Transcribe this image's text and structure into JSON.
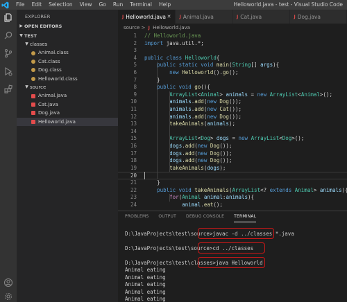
{
  "titlebar": {
    "menu": [
      "File",
      "Edit",
      "Selection",
      "View",
      "Go",
      "Run",
      "Terminal",
      "Help"
    ],
    "window_title": "Helloworld.java - test - Visual Studio Code"
  },
  "activity_icons": [
    "files-icon",
    "search-icon",
    "source-control-icon",
    "run-debug-icon",
    "extensions-icon",
    "account-icon",
    "settings-gear-icon"
  ],
  "sidebar": {
    "title": "EXPLORER",
    "open_editors": "OPEN EDITORS",
    "workspace": "TEST",
    "folders": [
      {
        "name": "classes",
        "files": [
          "Animal.class",
          "Cat.class",
          "Dog.class",
          "Helloworld.class"
        ]
      },
      {
        "name": "source",
        "files": [
          "Animal.java",
          "Cat.java",
          "Dog.java",
          "Helloworld.java"
        ]
      }
    ],
    "selected_file": "Helloworld.java"
  },
  "tabs": [
    {
      "label": "Helloworld.java",
      "active": true
    },
    {
      "label": "Animal.java",
      "active": false
    },
    {
      "label": "Cat.java",
      "active": false
    },
    {
      "label": "Dog.java",
      "active": false
    }
  ],
  "breadcrumb": {
    "folder": "source",
    "sep": ">",
    "icon": "J",
    "file": "Helloworld.java"
  },
  "editor": {
    "current_line": 20,
    "lines": [
      {
        "n": 1,
        "indent": 0,
        "t": [
          [
            "cm",
            "// Helloworld.java"
          ]
        ]
      },
      {
        "n": 2,
        "indent": 0,
        "t": [
          [
            "kw",
            "import "
          ],
          [
            "pl",
            "java.util.*;"
          ]
        ]
      },
      {
        "n": 3,
        "indent": 0,
        "t": []
      },
      {
        "n": 4,
        "indent": 0,
        "t": [
          [
            "kw",
            "public class "
          ],
          [
            "ty",
            "Helloworld"
          ],
          [
            "pl",
            "{"
          ]
        ]
      },
      {
        "n": 5,
        "indent": 1,
        "t": [
          [
            "kw",
            "public static void "
          ],
          [
            "fn",
            "main"
          ],
          [
            "pl",
            "("
          ],
          [
            "ty",
            "String"
          ],
          [
            "pl",
            "[] "
          ],
          [
            "var",
            "args"
          ],
          [
            "pl",
            "){"
          ]
        ]
      },
      {
        "n": 6,
        "indent": 2,
        "t": [
          [
            "kw",
            "new "
          ],
          [
            "fn",
            "Helloworld"
          ],
          [
            "pl",
            "()."
          ],
          [
            "fn",
            "go"
          ],
          [
            "pl",
            "();"
          ]
        ]
      },
      {
        "n": 7,
        "indent": 1,
        "t": [
          [
            "pl",
            "}"
          ]
        ]
      },
      {
        "n": 8,
        "indent": 1,
        "t": [
          [
            "kw",
            "public void "
          ],
          [
            "fn",
            "go"
          ],
          [
            "pl",
            "(){"
          ]
        ]
      },
      {
        "n": 9,
        "indent": 2,
        "t": [
          [
            "ty",
            "ArrayList"
          ],
          [
            "pl",
            "<"
          ],
          [
            "ty",
            "Animal"
          ],
          [
            "pl",
            "> "
          ],
          [
            "var",
            "animals"
          ],
          [
            "pl",
            " = "
          ],
          [
            "kw",
            "new "
          ],
          [
            "ty",
            "ArrayList"
          ],
          [
            "pl",
            "<"
          ],
          [
            "ty",
            "Animal"
          ],
          [
            "pl",
            ">();"
          ]
        ]
      },
      {
        "n": 10,
        "indent": 2,
        "t": [
          [
            "var",
            "animals"
          ],
          [
            "pl",
            "."
          ],
          [
            "fn",
            "add"
          ],
          [
            "pl",
            "("
          ],
          [
            "kw",
            "new "
          ],
          [
            "fn",
            "Dog"
          ],
          [
            "pl",
            "());"
          ]
        ]
      },
      {
        "n": 11,
        "indent": 2,
        "t": [
          [
            "var",
            "animals"
          ],
          [
            "pl",
            "."
          ],
          [
            "fn",
            "add"
          ],
          [
            "pl",
            "("
          ],
          [
            "kw",
            "new "
          ],
          [
            "fn",
            "Cat"
          ],
          [
            "pl",
            "());"
          ]
        ]
      },
      {
        "n": 12,
        "indent": 2,
        "t": [
          [
            "var",
            "animals"
          ],
          [
            "pl",
            "."
          ],
          [
            "fn",
            "add"
          ],
          [
            "pl",
            "("
          ],
          [
            "kw",
            "new "
          ],
          [
            "fn",
            "Dog"
          ],
          [
            "pl",
            "());"
          ]
        ]
      },
      {
        "n": 13,
        "indent": 2,
        "t": [
          [
            "fn",
            "takeAnimals"
          ],
          [
            "pl",
            "("
          ],
          [
            "var",
            "animals"
          ],
          [
            "pl",
            ");"
          ]
        ]
      },
      {
        "n": 14,
        "indent": 2,
        "t": []
      },
      {
        "n": 15,
        "indent": 2,
        "t": [
          [
            "ty",
            "ArrayList"
          ],
          [
            "pl",
            "<"
          ],
          [
            "ty",
            "Dog"
          ],
          [
            "pl",
            "> "
          ],
          [
            "var",
            "dogs"
          ],
          [
            "pl",
            " = "
          ],
          [
            "kw",
            "new "
          ],
          [
            "ty",
            "ArrayList"
          ],
          [
            "pl",
            "<"
          ],
          [
            "ty",
            "Dog"
          ],
          [
            "pl",
            ">();"
          ]
        ]
      },
      {
        "n": 16,
        "indent": 2,
        "t": [
          [
            "var",
            "dogs"
          ],
          [
            "pl",
            "."
          ],
          [
            "fn",
            "add"
          ],
          [
            "pl",
            "("
          ],
          [
            "kw",
            "new "
          ],
          [
            "fn",
            "Dog"
          ],
          [
            "pl",
            "());"
          ]
        ]
      },
      {
        "n": 17,
        "indent": 2,
        "t": [
          [
            "var",
            "dogs"
          ],
          [
            "pl",
            "."
          ],
          [
            "fn",
            "add"
          ],
          [
            "pl",
            "("
          ],
          [
            "kw",
            "new "
          ],
          [
            "fn",
            "Dog"
          ],
          [
            "pl",
            "());"
          ]
        ]
      },
      {
        "n": 18,
        "indent": 2,
        "t": [
          [
            "var",
            "dogs"
          ],
          [
            "pl",
            "."
          ],
          [
            "fn",
            "add"
          ],
          [
            "pl",
            "("
          ],
          [
            "kw",
            "new "
          ],
          [
            "fn",
            "Dog"
          ],
          [
            "pl",
            "());"
          ]
        ]
      },
      {
        "n": 19,
        "indent": 2,
        "t": [
          [
            "fn",
            "takeAnimals"
          ],
          [
            "pl",
            "("
          ],
          [
            "var",
            "dogs"
          ],
          [
            "pl",
            ");"
          ]
        ]
      },
      {
        "n": 20,
        "indent": 0,
        "t": []
      },
      {
        "n": 21,
        "indent": 1,
        "t": [
          [
            "pl",
            "}"
          ]
        ]
      },
      {
        "n": 22,
        "indent": 1,
        "t": [
          [
            "kw",
            "public void "
          ],
          [
            "fn",
            "takeAnimals"
          ],
          [
            "pl",
            "("
          ],
          [
            "ty",
            "ArrayList"
          ],
          [
            "pl",
            "<? "
          ],
          [
            "kw",
            "extends "
          ],
          [
            "ty",
            "Animal"
          ],
          [
            "pl",
            "> "
          ],
          [
            "var",
            "animals"
          ],
          [
            "pl",
            "){"
          ]
        ]
      },
      {
        "n": 23,
        "indent": 2,
        "t": [
          [
            "ctl",
            "for"
          ],
          [
            "pl",
            "("
          ],
          [
            "ty",
            "Animal"
          ],
          [
            "pl",
            " "
          ],
          [
            "var",
            "animal"
          ],
          [
            "pl",
            ":"
          ],
          [
            "var",
            "animals"
          ],
          [
            "pl",
            "){"
          ]
        ]
      },
      {
        "n": 24,
        "indent": 3,
        "t": [
          [
            "var",
            "animal"
          ],
          [
            "pl",
            "."
          ],
          [
            "fn",
            "eat"
          ],
          [
            "pl",
            "();"
          ]
        ]
      }
    ]
  },
  "panel": {
    "tabs": [
      "PROBLEMS",
      "OUTPUT",
      "DEBUG CONSOLE",
      "TERMINAL"
    ],
    "active_tab": "TERMINAL",
    "terminal_lines": [
      "",
      "D:\\JavaProjects\\test\\source>javac -d ../classes *.java",
      "",
      "D:\\JavaProjects\\test\\source>cd ../classes",
      "",
      "D:\\JavaProjects\\test\\classes>java Helloworld",
      "Animal eating",
      "Animal eating",
      "Animal eating",
      "Animal eating",
      "Animal eating",
      "Animal eating"
    ],
    "highlight_color": "#d01818"
  }
}
